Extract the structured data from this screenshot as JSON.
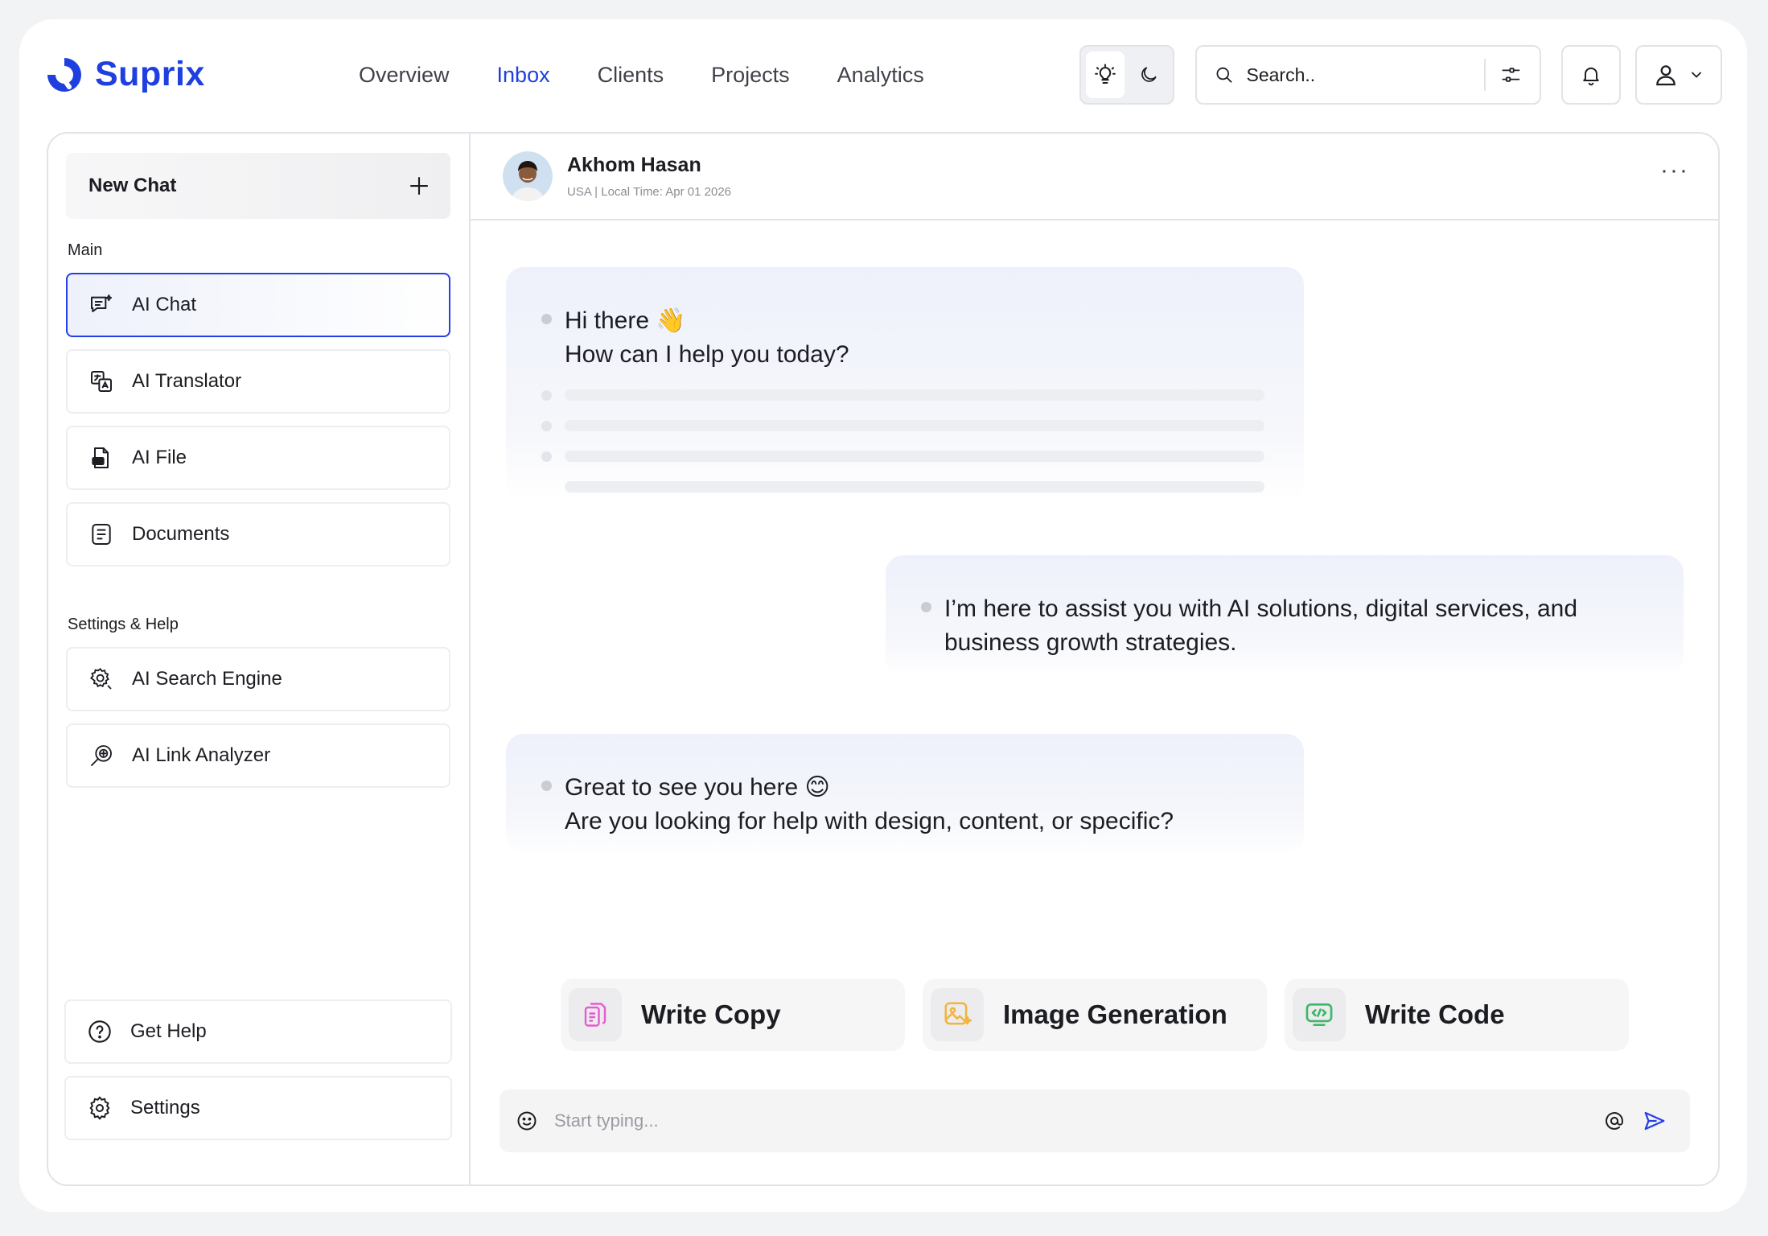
{
  "brand": {
    "name": "Suprix",
    "color": "#1f3fe0"
  },
  "nav": [
    {
      "label": "Overview",
      "active": false
    },
    {
      "label": "Inbox",
      "active": true
    },
    {
      "label": "Clients",
      "active": false
    },
    {
      "label": "Projects",
      "active": false
    },
    {
      "label": "Analytics",
      "active": false
    }
  ],
  "search": {
    "placeholder": "Search.."
  },
  "icons": {
    "theme_light": "lightbulb-icon",
    "theme_dark": "moon-icon",
    "search": "search-icon",
    "filter": "sliders-icon",
    "bell": "bell-icon",
    "user": "user-icon",
    "chevron": "chevron-down-icon"
  },
  "sidebar": {
    "new_chat": "New Chat",
    "main_label": "Main",
    "main_items": [
      {
        "label": "AI Chat",
        "icon": "ai-chat-icon",
        "active": true
      },
      {
        "label": "AI Translator",
        "icon": "translate-icon"
      },
      {
        "label": "AI File",
        "icon": "ai-file-icon"
      },
      {
        "label": "Documents",
        "icon": "document-icon"
      }
    ],
    "settings_label": "Settings & Help",
    "settings_items": [
      {
        "label": "AI Search Engine",
        "icon": "gear-search-icon"
      },
      {
        "label": "AI Link Analyzer",
        "icon": "link-analyzer-icon"
      }
    ],
    "bottom_items": [
      {
        "label": "Get Help",
        "icon": "help-circle-icon"
      },
      {
        "label": "Settings",
        "icon": "settings-gear-icon"
      }
    ]
  },
  "chat": {
    "contact": {
      "name": "Akhom Hasan",
      "sub": "USA | Local Time: Apr 01 2026"
    },
    "messages": [
      {
        "line1": "Hi there 👋",
        "line2": "How can I help you today?"
      },
      {
        "text": "I’m here to assist you with AI solutions, digital services, and business growth strategies."
      },
      {
        "line1": "Great to see you here 😊",
        "line2": "Are you looking for help with design, content, or specific?"
      }
    ],
    "suggestions": [
      {
        "label": "Write Copy",
        "icon": "copy-icon",
        "color": "#e85bd0"
      },
      {
        "label": "Image Generation",
        "icon": "image-gen-icon",
        "color": "#f2b43c"
      },
      {
        "label": "Write Code",
        "icon": "code-icon",
        "color": "#3db86a"
      }
    ],
    "composer": {
      "placeholder": "Start typing..."
    }
  },
  "colors": {
    "accent": "#2440e6",
    "border": "#e1e3e8",
    "bubble": "#eef1fb"
  }
}
